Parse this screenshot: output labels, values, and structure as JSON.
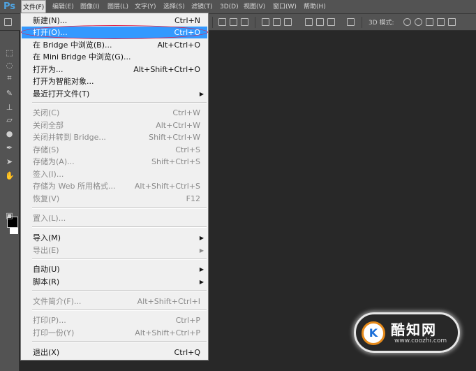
{
  "app": {
    "logo": "Ps",
    "menubar": [
      {
        "label": "文件(F)",
        "active": true
      },
      {
        "label": "编辑(E)"
      },
      {
        "label": "图像(I)"
      },
      {
        "label": "图层(L)"
      },
      {
        "label": "文字(Y)"
      },
      {
        "label": "选择(S)"
      },
      {
        "label": "滤镜(T)"
      },
      {
        "label": "3D(D)"
      },
      {
        "label": "视图(V)"
      },
      {
        "label": "窗口(W)"
      },
      {
        "label": "帮助(H)"
      }
    ],
    "options_bar": {
      "mode_label": "3D 模式:"
    }
  },
  "file_menu": {
    "items": [
      {
        "label": "新建(N)...",
        "shortcut": "Ctrl+N",
        "disabled": false
      },
      {
        "label": "打开(O)...",
        "shortcut": "Ctrl+O",
        "disabled": false,
        "highlighted": true
      },
      {
        "label": "在 Bridge 中浏览(B)...",
        "shortcut": "Alt+Ctrl+O",
        "disabled": false
      },
      {
        "label": "在 Mini Bridge 中浏览(G)...",
        "shortcut": "",
        "disabled": false
      },
      {
        "label": "打开为...",
        "shortcut": "Alt+Shift+Ctrl+O",
        "disabled": false
      },
      {
        "label": "打开为智能对象...",
        "shortcut": "",
        "disabled": false
      },
      {
        "label": "最近打开文件(T)",
        "shortcut": "",
        "disabled": false,
        "submenu": true
      },
      {
        "label": "关闭(C)",
        "shortcut": "Ctrl+W",
        "disabled": true
      },
      {
        "label": "关闭全部",
        "shortcut": "Alt+Ctrl+W",
        "disabled": true
      },
      {
        "label": "关闭并转到 Bridge...",
        "shortcut": "Shift+Ctrl+W",
        "disabled": true
      },
      {
        "label": "存储(S)",
        "shortcut": "Ctrl+S",
        "disabled": true
      },
      {
        "label": "存储为(A)...",
        "shortcut": "Shift+Ctrl+S",
        "disabled": true
      },
      {
        "label": "签入(I)...",
        "shortcut": "",
        "disabled": true
      },
      {
        "label": "存储为 Web 所用格式...",
        "shortcut": "Alt+Shift+Ctrl+S",
        "disabled": true
      },
      {
        "label": "恢复(V)",
        "shortcut": "F12",
        "disabled": true
      },
      {
        "label": "置入(L)...",
        "shortcut": "",
        "disabled": true
      },
      {
        "label": "导入(M)",
        "shortcut": "",
        "disabled": false,
        "submenu": true
      },
      {
        "label": "导出(E)",
        "shortcut": "",
        "disabled": true,
        "submenu": true
      },
      {
        "label": "自动(U)",
        "shortcut": "",
        "disabled": false,
        "submenu": true
      },
      {
        "label": "脚本(R)",
        "shortcut": "",
        "disabled": false,
        "submenu": true
      },
      {
        "label": "文件简介(F)...",
        "shortcut": "Alt+Shift+Ctrl+I",
        "disabled": true
      },
      {
        "label": "打印(P)...",
        "shortcut": "Ctrl+P",
        "disabled": true
      },
      {
        "label": "打印一份(Y)",
        "shortcut": "Alt+Shift+Ctrl+P",
        "disabled": true
      },
      {
        "label": "退出(X)",
        "shortcut": "Ctrl+Q",
        "disabled": false
      }
    ]
  },
  "watermark": {
    "title": "酷知网",
    "url": "www.coozhi.com",
    "logo_letter": "K"
  },
  "colors": {
    "highlight": "#3399ff",
    "annotation": "#e0234a",
    "foreground_swatch": "#000000",
    "background_swatch": "#ffffff"
  },
  "icons": [
    "move-tool-icon",
    "marquee-tool-icon",
    "lasso-tool-icon",
    "crop-tool-icon",
    "eyedropper-tool-icon",
    "brush-tool-icon",
    "clone-stamp-icon",
    "eraser-tool-icon",
    "blur-tool-icon",
    "pen-tool-icon",
    "path-select-icon",
    "hand-tool-icon",
    "submenu-arrow-icon"
  ]
}
